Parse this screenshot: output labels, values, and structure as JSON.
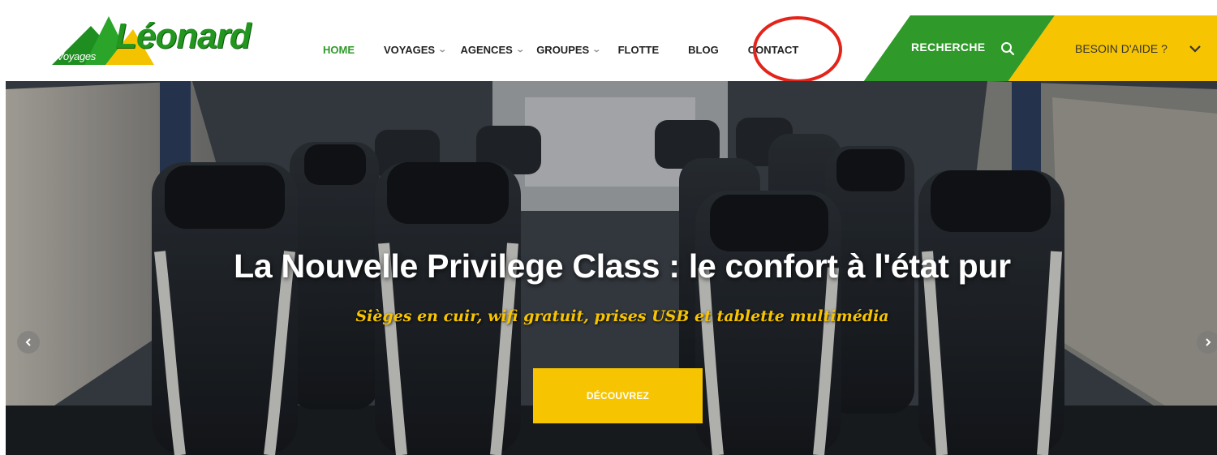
{
  "logo": {
    "small_text": "Voyages",
    "main_text": "Léonard"
  },
  "nav": {
    "items": [
      {
        "label": "HOME",
        "active": true,
        "dropdown": false
      },
      {
        "label": "VOYAGES",
        "active": false,
        "dropdown": true
      },
      {
        "label": "AGENCES",
        "active": false,
        "dropdown": true
      },
      {
        "label": "GROUPES",
        "active": false,
        "dropdown": true
      },
      {
        "label": "FLOTTE",
        "active": false,
        "dropdown": false
      },
      {
        "label": "BLOG",
        "active": false,
        "dropdown": false
      },
      {
        "label": "CONTACT",
        "active": false,
        "dropdown": false
      }
    ]
  },
  "search": {
    "label": "RECHERCHE",
    "icon": "search-icon"
  },
  "help": {
    "label": "BESOIN D'AIDE ?",
    "icon": "chevron-down-icon"
  },
  "hero": {
    "title": "La Nouvelle Privilege Class : le confort à l'état pur",
    "subtitle": "Sièges en cuir, wifi gratuit, prises USB et tablette multimédia",
    "cta_label": "DÉCOUVREZ",
    "prev_icon": "chevron-left-icon",
    "next_icon": "chevron-right-icon"
  },
  "colors": {
    "brand_green": "#2f9a2a",
    "brand_yellow": "#f6c400",
    "annotation_red": "#e3241b"
  }
}
